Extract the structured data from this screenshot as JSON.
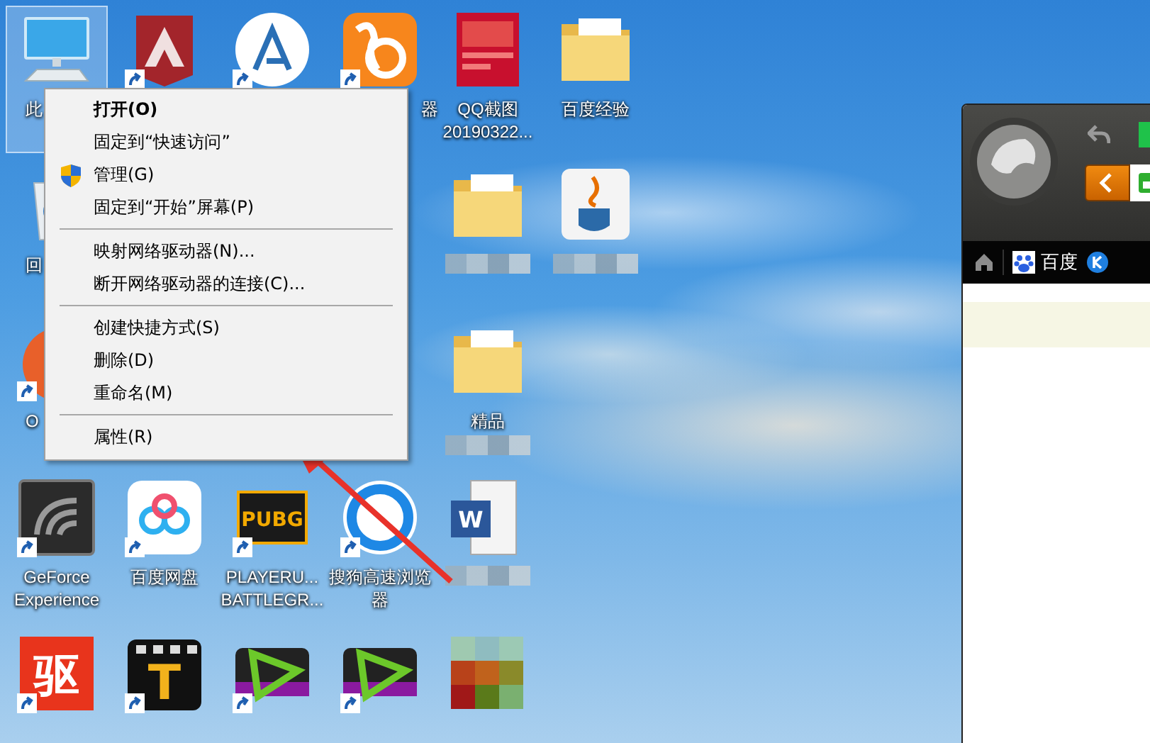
{
  "desktop": {
    "columns": [
      {
        "icons": [
          {
            "kind": "computer",
            "label": "此",
            "selected": true,
            "shortcut": false,
            "cut": true
          },
          {
            "kind": "recycle",
            "label": "回",
            "selected": false,
            "shortcut": false,
            "cut": true
          },
          {
            "kind": "orange",
            "label": "O",
            "selected": false,
            "shortcut": true,
            "cut": true
          },
          {
            "kind": "geforce",
            "label": "GeForce Experience",
            "selected": false,
            "shortcut": true,
            "cut": false
          },
          {
            "kind": "qudong",
            "logo_text": "驱",
            "selected": false,
            "shortcut": true
          }
        ]
      },
      {
        "icons": [
          {
            "kind": "apex",
            "selected": false,
            "shortcut": true
          },
          {
            "kind": "empty"
          },
          {
            "kind": "empty"
          },
          {
            "kind": "baidupan",
            "label": "百度网盘",
            "selected": false,
            "shortcut": true,
            "cut": false
          },
          {
            "kind": "leite",
            "logo_text": "T",
            "selected": false,
            "shortcut": true
          }
        ]
      },
      {
        "icons": [
          {
            "kind": "arc",
            "selected": false,
            "shortcut": true
          },
          {
            "kind": "empty"
          },
          {
            "kind": "empty"
          },
          {
            "kind": "pubg",
            "logo_text": "PUBG",
            "label": "PLAYERU... BATTLEGR...",
            "selected": false,
            "shortcut": true,
            "cut": false
          },
          {
            "kind": "edius",
            "selected": false,
            "shortcut": true
          }
        ]
      },
      {
        "icons": [
          {
            "kind": "uc",
            "label": "器",
            "selected": false,
            "shortcut": true,
            "cut": true
          },
          {
            "kind": "empty"
          },
          {
            "kind": "empty"
          },
          {
            "kind": "sogou",
            "label": "搜狗高速浏览器",
            "selected": false,
            "shortcut": true,
            "cut": false
          },
          {
            "kind": "edius",
            "selected": false,
            "shortcut": true
          }
        ]
      },
      {
        "icons": [
          {
            "kind": "qqshot",
            "label": "QQ截图 20190322...",
            "selected": false,
            "shortcut": false,
            "cut": false
          },
          {
            "kind": "folder",
            "selected": false,
            "shortcut": false,
            "blurred": true
          },
          {
            "kind": "folder",
            "label": "精品",
            "selected": false,
            "shortcut": false,
            "cut": false,
            "blurred": true
          },
          {
            "kind": "word",
            "logo_text": "W",
            "selected": false,
            "shortcut": false,
            "blurred": true
          },
          {
            "kind": "mosaic",
            "selected": false,
            "shortcut": false
          }
        ]
      },
      {
        "icons": [
          {
            "kind": "folder",
            "label": "百度经验",
            "selected": false,
            "shortcut": false,
            "cut": false
          },
          {
            "kind": "java",
            "selected": false,
            "shortcut": false,
            "blurred": true
          },
          {
            "kind": "empty"
          },
          {
            "kind": "empty"
          },
          {
            "kind": "empty"
          }
        ]
      }
    ]
  },
  "context_menu": {
    "groups": [
      [
        {
          "label": "打开(O)",
          "bold": true
        },
        {
          "label": "固定到“快速访问”",
          "bold": false
        },
        {
          "label": "管理(G)",
          "bold": false,
          "kind": "shield"
        },
        {
          "label": "固定到“开始”屏幕(P)",
          "bold": false
        }
      ],
      [
        {
          "label": "映射网络驱动器(N)...",
          "bold": false
        },
        {
          "label": "断开网络驱动器的连接(C)...",
          "bold": false
        }
      ],
      [
        {
          "label": "创建快捷方式(S)",
          "bold": false
        },
        {
          "label": "删除(D)",
          "bold": false
        },
        {
          "label": "重命名(M)",
          "bold": false
        }
      ],
      [
        {
          "label": "属性(R)",
          "bold": false
        }
      ]
    ]
  },
  "browser": {
    "bookmarks": [
      {
        "kind": "baidu",
        "label": "百度"
      },
      {
        "kind": "k"
      }
    ]
  }
}
